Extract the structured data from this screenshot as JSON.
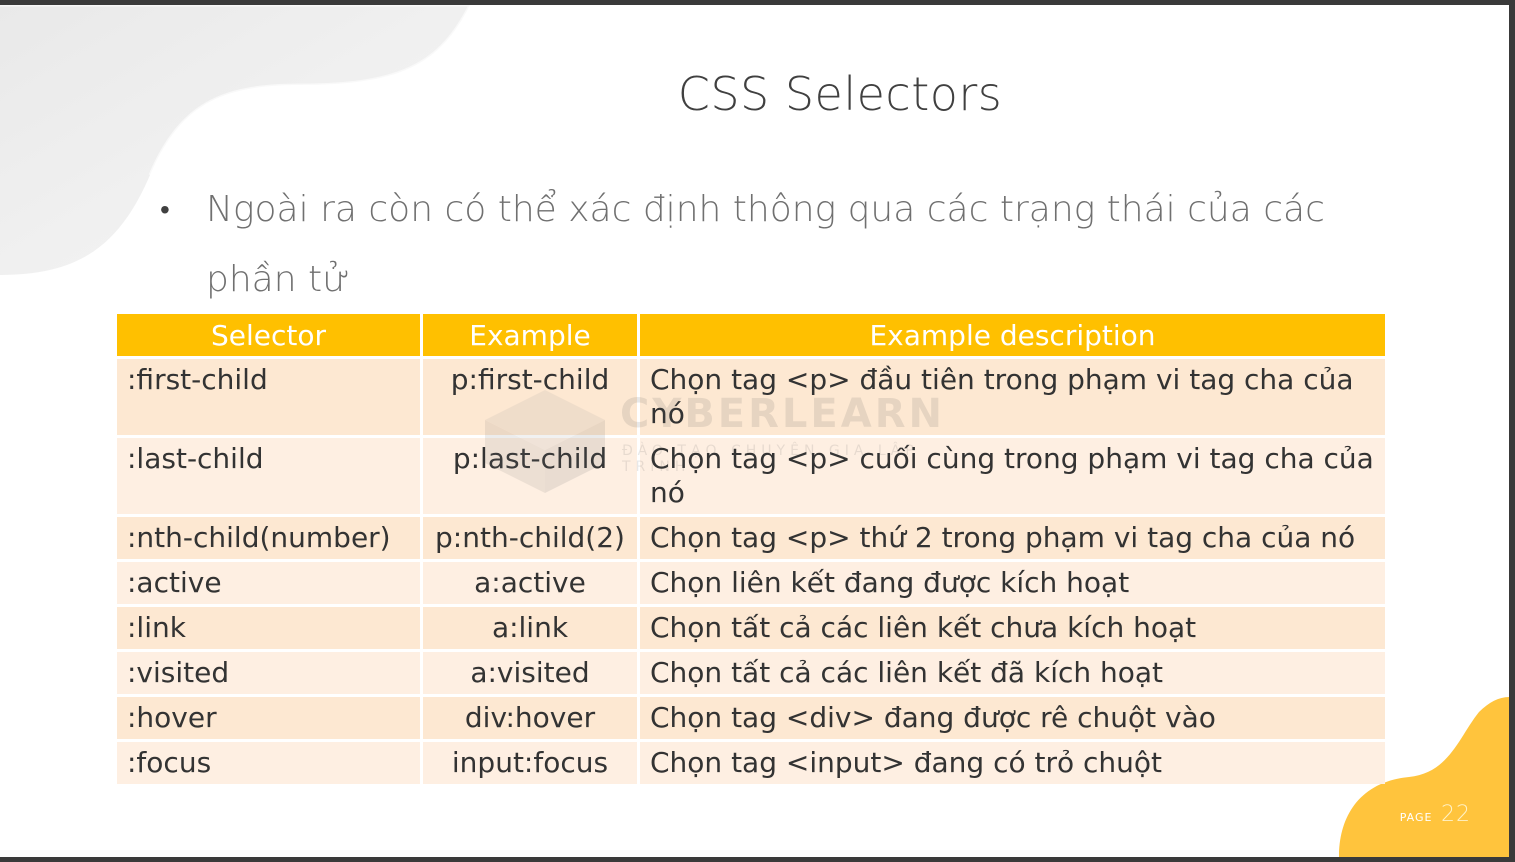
{
  "slide": {
    "title": "CSS Selectors",
    "bullet_text": "Ngoài ra còn có thể xác định thông qua các trạng thái của các phần tử",
    "watermark": {
      "name": "CYBERLEARN",
      "tagline": "ĐÀO TẠO CHUYÊN GIA LẬP TRÌNH"
    },
    "page": {
      "label": "PAGE",
      "number": "22"
    },
    "colors": {
      "header": "#ffc000",
      "row_odd": "#fde8d2",
      "row_even": "#feefe2",
      "accent_blob": "#ffc43d"
    }
  },
  "table": {
    "headers": [
      "Selector",
      "Example",
      "Example description"
    ],
    "rows": [
      {
        "selector": ":first-child",
        "example": "p:first-child",
        "description": "Chọn tag <p> đầu tiên trong phạm vi tag cha của nó"
      },
      {
        "selector": ":last-child",
        "example": "p:last-child",
        "description": "Chọn tag <p> cuối cùng trong phạm vi tag cha của nó"
      },
      {
        "selector": ":nth-child(number)",
        "example": "p:nth-child(2)",
        "description": "Chọn tag <p> thứ 2 trong phạm vi tag cha của nó"
      },
      {
        "selector": ":active",
        "example": "a:active",
        "description": "Chọn liên kết đang được kích hoạt"
      },
      {
        "selector": ":link",
        "example": "a:link",
        "description": "Chọn tất cả các liên kết chưa kích hoạt"
      },
      {
        "selector": ":visited",
        "example": "a:visited",
        "description": "Chọn tất cả các liên kết đã kích hoạt"
      },
      {
        "selector": ":hover",
        "example": "div:hover",
        "description": "Chọn tag <div> đang được rê chuột vào"
      },
      {
        "selector": ":focus",
        "example": "input:focus",
        "description": "Chọn tag <input> đang có trỏ chuột"
      }
    ]
  }
}
